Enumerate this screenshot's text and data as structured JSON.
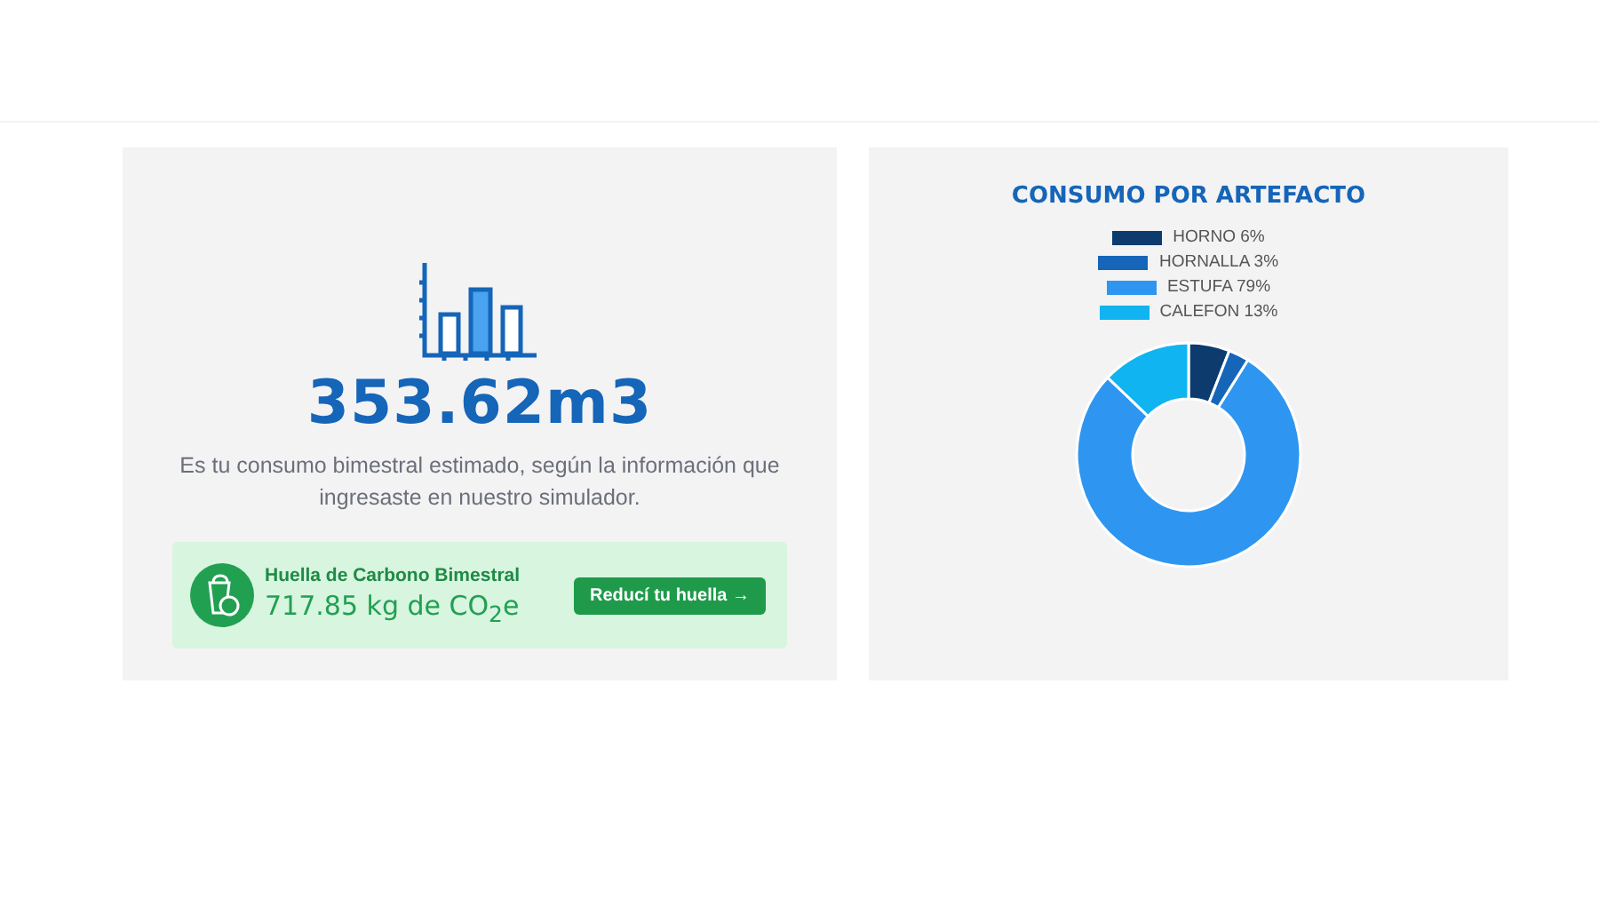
{
  "consumption": {
    "value": "353.62m3",
    "description": "Es tu consumo bimestral estimado, según la información que ingresaste en nuestro simulador."
  },
  "footprint": {
    "title": "Huella de Carbono Bimestral",
    "value": "717.85 kg de CO$_{2}$e",
    "button": "Reducí tu huella →"
  },
  "appliances": {
    "title": "CONSUMO POR ARTEFACTO",
    "legend": [
      {
        "color": "#0d3b6e"
      },
      {
        "color": "#1565b8"
      },
      {
        "color": "#2e96f0"
      },
      {
        "color": "#0fb4f0"
      }
    ],
    "chart_data": {
      "type": "donut",
      "categories": [
        "HORNO 6%",
        "HORNALLA 3%",
        "ESTUFA 79%",
        "CALEFON 13%"
      ],
      "values": [
        6,
        3,
        79,
        13
      ]
    }
  }
}
